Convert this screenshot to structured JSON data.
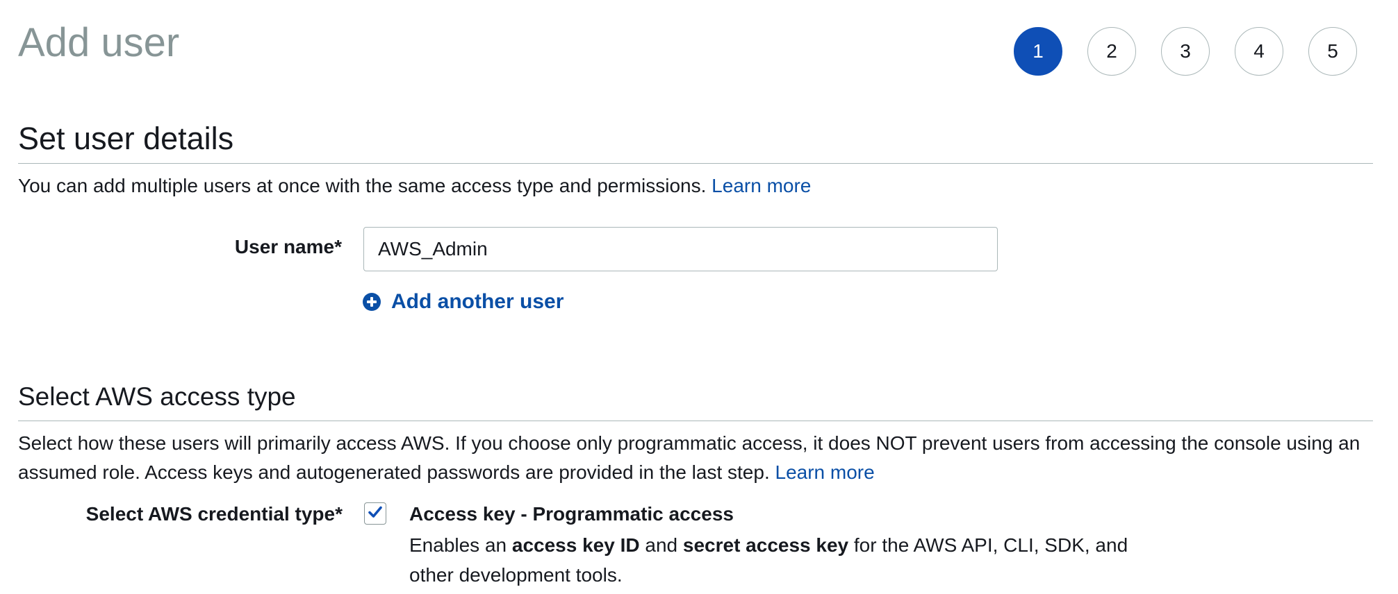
{
  "page_title": "Add user",
  "steps": [
    {
      "label": "1",
      "active": true
    },
    {
      "label": "2",
      "active": false
    },
    {
      "label": "3",
      "active": false
    },
    {
      "label": "4",
      "active": false
    },
    {
      "label": "5",
      "active": false
    }
  ],
  "user_details": {
    "heading": "Set user details",
    "description": "You can add multiple users at once with the same access type and permissions.",
    "learn_more": "Learn more",
    "username_label": "User name*",
    "username_value": "AWS_Admin",
    "add_another_user": "Add another user"
  },
  "access_type": {
    "heading": "Select AWS access type",
    "description": "Select how these users will primarily access AWS. If you choose only programmatic access, it does NOT prevent users from accessing the console using an assumed role. Access keys and autogenerated passwords are provided in the last step.",
    "learn_more": "Learn more",
    "credential_label": "Select AWS credential type*",
    "options": [
      {
        "checked": true,
        "title": "Access key - Programmatic access",
        "desc_prefix": "Enables an",
        "desc_bold_1": "access key ID",
        "desc_and": "and",
        "desc_bold_2": "secret access key",
        "desc_suffix": "for the AWS API, CLI, SDK, and other development tools."
      }
    ]
  },
  "colors": {
    "accent": "#0f4fb6",
    "link": "#0a4fa6",
    "title_gray": "#879596",
    "border": "#aab7b8"
  }
}
